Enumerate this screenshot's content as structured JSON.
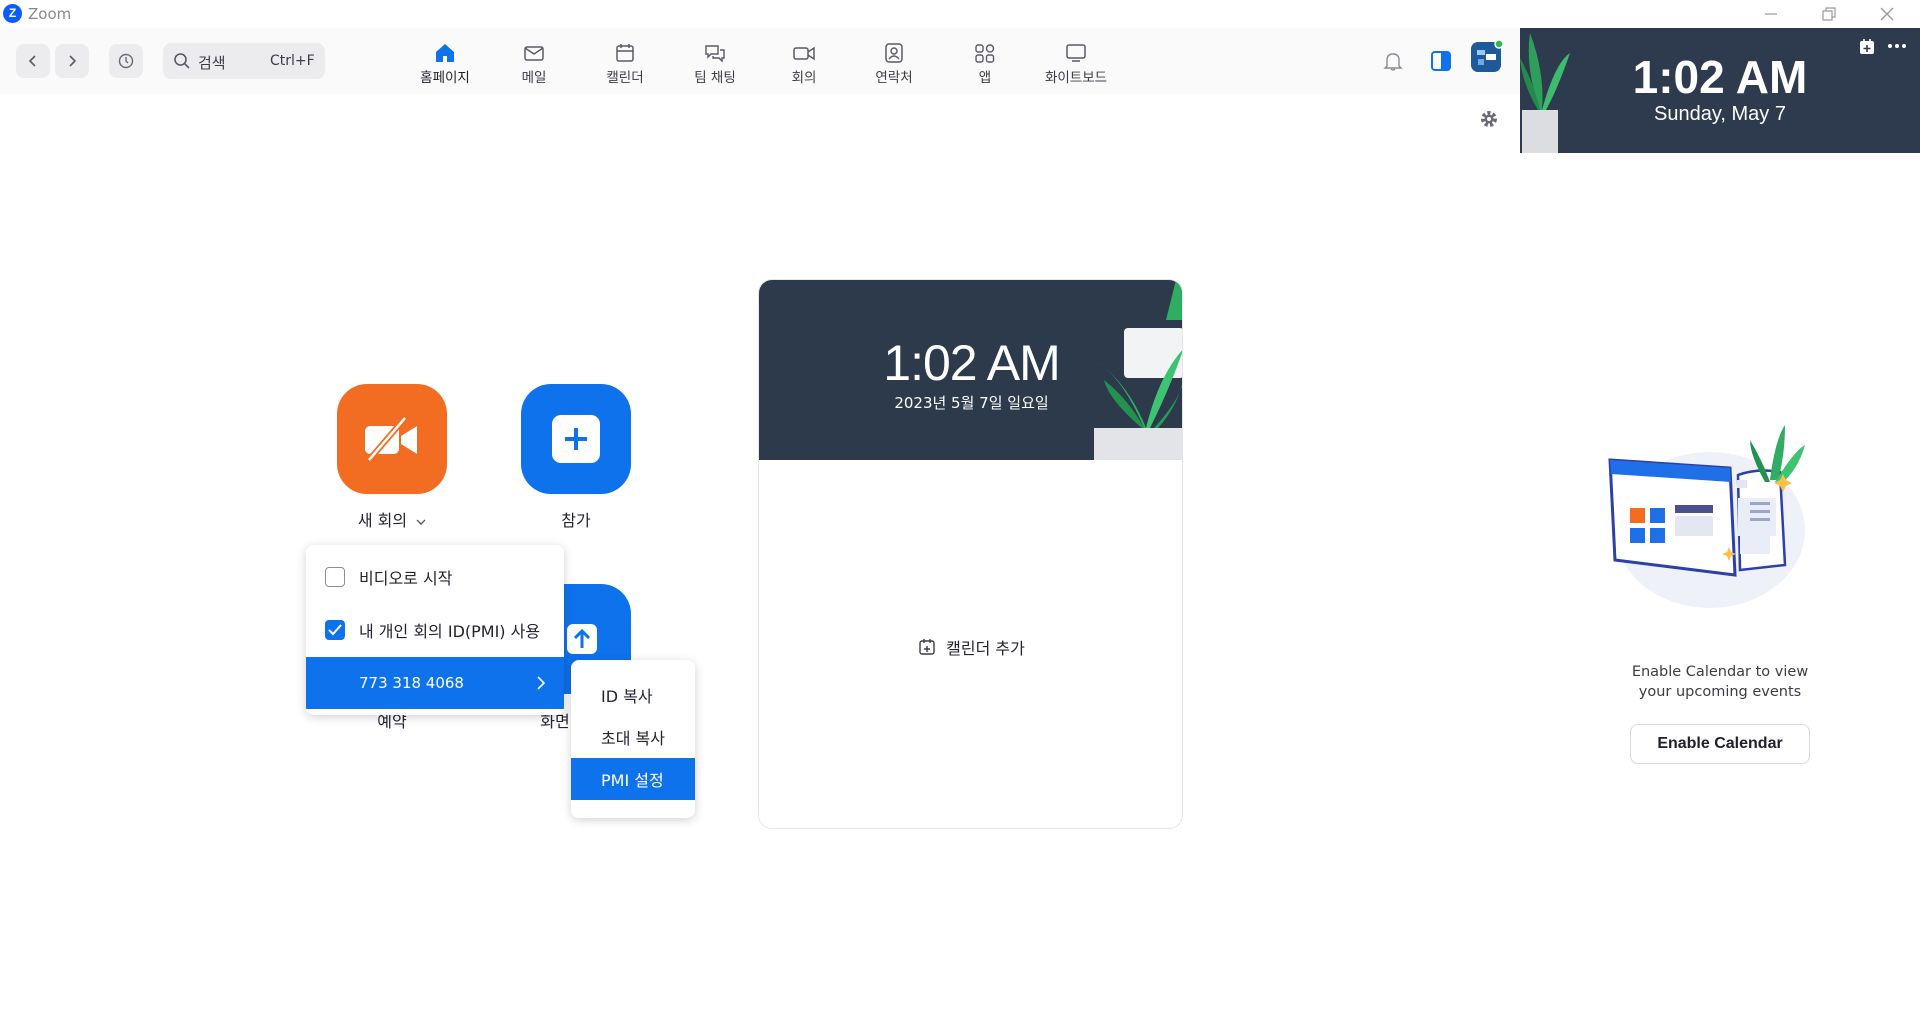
{
  "app": {
    "title": "Zoom",
    "logo_letter": "Z"
  },
  "search": {
    "label": "검색",
    "shortcut": "Ctrl+F"
  },
  "tabs": [
    {
      "label": "홈페이지",
      "icon": "home-icon",
      "active": true
    },
    {
      "label": "메일",
      "icon": "mail-icon"
    },
    {
      "label": "캘린더",
      "icon": "calendar-icon"
    },
    {
      "label": "팀 채팅",
      "icon": "chat-icon"
    },
    {
      "label": "회의",
      "icon": "video-icon"
    },
    {
      "label": "연락처",
      "icon": "contacts-icon"
    },
    {
      "label": "앱",
      "icon": "apps-icon"
    },
    {
      "label": "화이트보드",
      "icon": "whiteboard-icon"
    }
  ],
  "clock_panel": {
    "time": "1:02 AM",
    "date": "Sunday, May 7"
  },
  "actions": {
    "new_meeting": {
      "label": "새 회의",
      "color": "#f26d21"
    },
    "join": {
      "label": "참가",
      "color": "#0e72ed"
    },
    "schedule": {
      "label": "예약"
    },
    "share_screen": {
      "label": "화면"
    }
  },
  "new_meeting_menu": {
    "items": [
      {
        "label": "비디오로 시작",
        "checked": false
      },
      {
        "label": "내 개인 회의 ID(PMI) 사용",
        "checked": true
      }
    ],
    "pmi": "773 318 4068"
  },
  "pmi_submenu": {
    "items": [
      "ID 복사",
      "초대 복사",
      "PMI 설정"
    ],
    "selected": "PMI 설정"
  },
  "calendar_card": {
    "time": "1:02 AM",
    "date": "2023년 5월 7일 일요일",
    "add_label": "캘린더 추가"
  },
  "enable_calendar": {
    "text_line1": "Enable Calendar to view",
    "text_line2": "your upcoming events",
    "button": "Enable Calendar"
  },
  "colors": {
    "accent": "#0e72ed",
    "orange": "#f26d21",
    "dark_panel": "#2e3b4e"
  }
}
